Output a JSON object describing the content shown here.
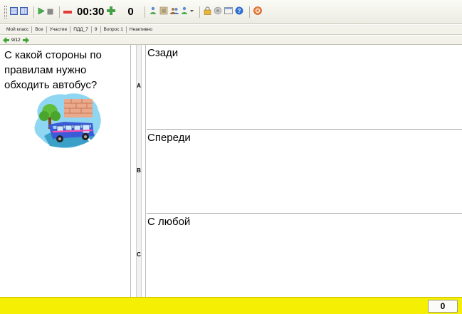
{
  "toolbar": {
    "timer": "00:30",
    "counter": "0",
    "icons": [
      "grid-icon",
      "grid-icon",
      "play-icon",
      "stop-icon",
      "minus-icon",
      "plus-icon",
      "person-icon",
      "list-icon",
      "group-icon",
      "person-dropdown-icon",
      "lock-icon",
      "camera-icon",
      "window-icon",
      "help-icon",
      "exit-icon"
    ]
  },
  "infobar": {
    "items": [
      "Мой класс",
      "Все",
      "Участие",
      "ПДД_7",
      "9",
      "Вопрос 1",
      "Неактивно"
    ]
  },
  "nav": {
    "position": "9/12"
  },
  "question": {
    "text": "С какой стороны по правилам нужно обходить автобус?"
  },
  "answers": [
    {
      "letter": "A",
      "text": "Сзади"
    },
    {
      "letter": "B",
      "text": "Спереди"
    },
    {
      "letter": "C",
      "text": "С любой"
    }
  ],
  "status": {
    "score": "0"
  },
  "colors": {
    "status_bar": "#f5ef03",
    "timer_minus": "#e53935",
    "plus": "#43a047"
  }
}
